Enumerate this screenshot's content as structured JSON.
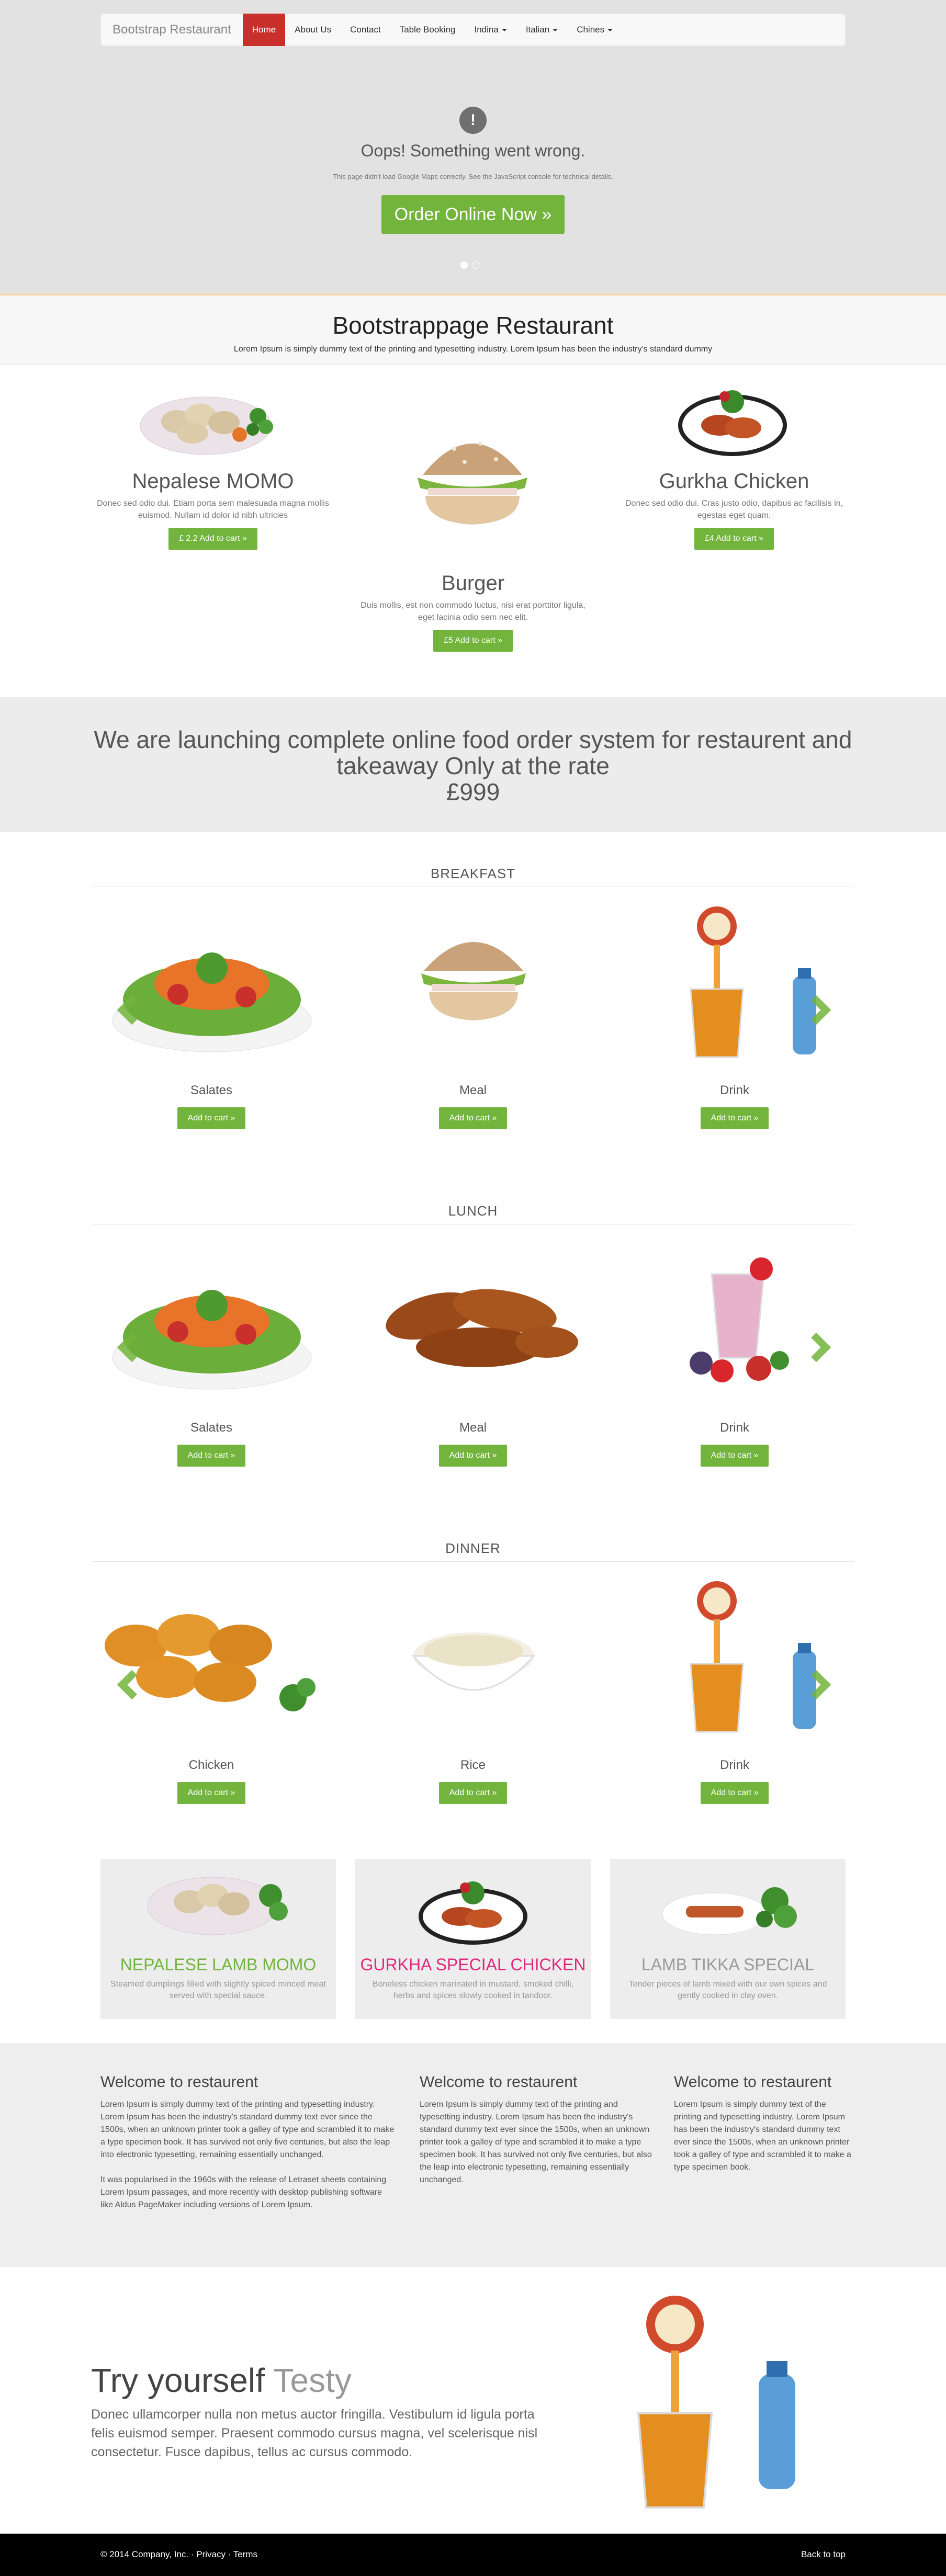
{
  "navbar": {
    "brand": "Bootstrap Restaurant",
    "items": [
      {
        "label": "Home",
        "active": true
      },
      {
        "label": "About Us"
      },
      {
        "label": "Contact"
      },
      {
        "label": "Table Booking"
      },
      {
        "label": "Indina",
        "dropdown": true
      },
      {
        "label": "Italian",
        "dropdown": true
      },
      {
        "label": "Chines",
        "dropdown": true
      }
    ]
  },
  "hero": {
    "error_title": "Oops! Something went wrong.",
    "error_sub": "This page didn't load Google Maps correctly. See the JavaScript console for technical details.",
    "order_button": "Order Online Now »"
  },
  "title_band": {
    "title": "Bootstrappage Restaurant",
    "subtitle": "Lorem Ipsum is simply dummy text of the printing and typesetting industry. Lorem Ipsum has been the industry's standard dummy"
  },
  "featured": [
    {
      "name": "Nepalese MOMO",
      "desc": "Donec sed odio dui. Etiam porta sem malesuada magna mollis euismod. Nullam id dolor id nibh ultricies",
      "button": "£ 2.2 Add to cart »"
    },
    {
      "name": "Burger",
      "desc": "Duis mollis, est non commodo luctus, nisi erat porttitor ligula, eget lacinia odio sem nec elit.",
      "button": "£5 Add to cart »"
    },
    {
      "name": "Gurkha Chicken",
      "desc": "Donec sed odio dui. Cras justo odio, dapibus ac facilisis in, egestas eget quam.",
      "button": "£4 Add to cart »"
    }
  ],
  "launch": {
    "line1": "We are launching complete online food order system for restaurent and",
    "line2": "takeaway Only at the rate",
    "line3": "£999"
  },
  "menus": [
    {
      "title": "BREAKFAST",
      "items": [
        {
          "name": "Salates",
          "button": "Add to cart »"
        },
        {
          "name": "Meal",
          "button": "Add to cart »"
        },
        {
          "name": "Drink",
          "button": "Add to cart »"
        }
      ]
    },
    {
      "title": "LUNCH",
      "items": [
        {
          "name": "Salates",
          "button": "Add to cart »"
        },
        {
          "name": "Meal",
          "button": "Add to cart »"
        },
        {
          "name": "Drink",
          "button": "Add to cart »"
        }
      ]
    },
    {
      "title": "DINNER",
      "items": [
        {
          "name": "Chicken",
          "button": "Add to cart »"
        },
        {
          "name": "Rice",
          "button": "Add to cart »"
        },
        {
          "name": "Drink",
          "button": "Add to cart »"
        }
      ]
    }
  ],
  "specials": [
    {
      "title": "NEPALESE LAMB MOMO",
      "color": "#72b43c",
      "desc": "Steamed dumplings filled with slightly spiced minced meat served with special sauce."
    },
    {
      "title": "GURKHA SPECIAL CHICKEN",
      "color": "#e0287a",
      "desc": "Boneless chicken marinated in mustard, smoked chilli, herbs and spices slowly cooked in tandoor."
    },
    {
      "title": "LAMB TIKKA SPECIAL",
      "color": "#9a9a9a",
      "desc": "Tender pieces of lamb mixed with our own spices and gently cooked in clay oven."
    }
  ],
  "welcome": [
    {
      "title": "Welcome to restaurent",
      "p1": "Lorem Ipsum is simply dummy text of the printing and typesetting industry. Lorem Ipsum has been the industry's standard dummy text ever since the 1500s, when an unknown printer took a galley of type and scrambled it to make a type specimen book. It has survived not only five centuries, but also the leap into electronic typesetting, remaining essentially unchanged.",
      "p2": "It was popularised in the 1960s with the release of Letraset sheets containing Lorem Ipsum passages, and more recently with desktop publishing software like Aldus PageMaker including versions of Lorem Ipsum."
    },
    {
      "title": "Welcome to restaurent",
      "p1": "Lorem Ipsum is simply dummy text of the printing and typesetting industry. Lorem Ipsum has been the industry's standard dummy text ever since the 1500s, when an unknown printer took a galley of type and scrambled it to make a type specimen book. It has survived not only five centuries, but also the leap into electronic typesetting, remaining essentially unchanged."
    },
    {
      "title": "Welcome to restaurent",
      "p1": "Lorem Ipsum is simply dummy text of the printing and typesetting industry. Lorem Ipsum has been the industry's standard dummy text ever since the 1500s, when an unknown printer took a galley of type and scrambled it to make a type specimen book."
    }
  ],
  "try": {
    "title_main": "Try yourself",
    "title_accent": "Testy",
    "text": "Donec ullamcorper nulla non metus auctor fringilla. Vestibulum id ligula porta felis euismod semper. Praesent commodo cursus magna, vel scelerisque nisl consectetur. Fusce dapibus, tellus ac cursus commodo."
  },
  "footer": {
    "copyright": "© 2014 Company, Inc. · Privacy · Terms",
    "back_to_top": "Back to top"
  },
  "colors": {
    "accent_green": "#72b43c",
    "nav_active": "#c9302c"
  }
}
